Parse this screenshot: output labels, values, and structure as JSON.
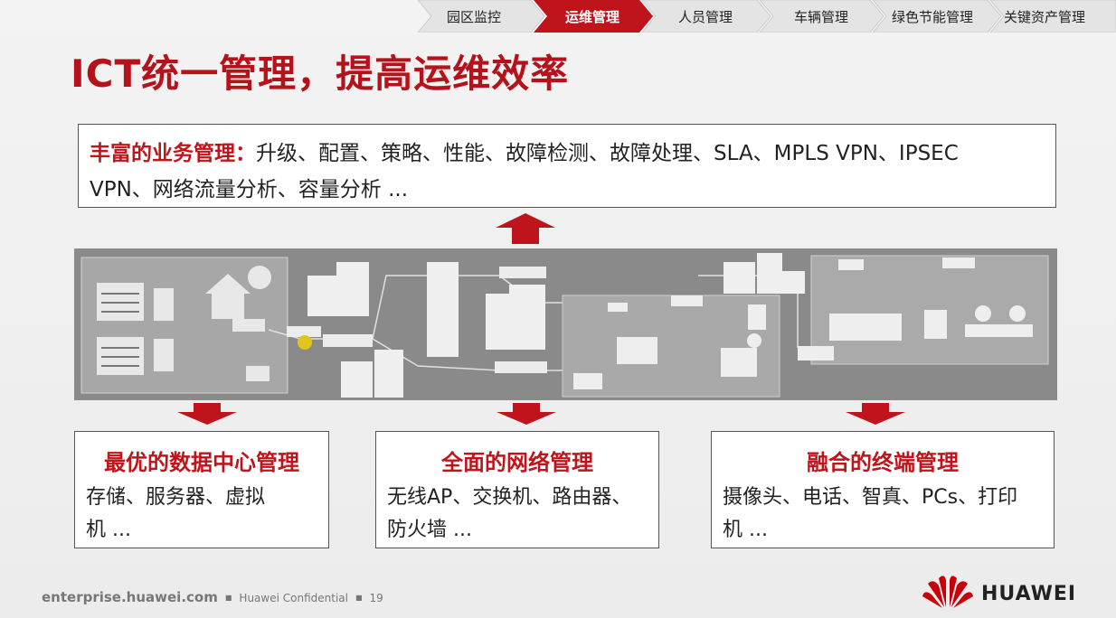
{
  "nav": {
    "tabs": [
      {
        "label": "园区监控"
      },
      {
        "label": "运维管理",
        "active": true
      },
      {
        "label": "人员管理"
      },
      {
        "label": "车辆管理"
      },
      {
        "label": "绿色节能管理"
      },
      {
        "label": "关键资产管理"
      }
    ],
    "active_color": "#c0141c"
  },
  "title": "ICT统一管理，提高运维效率",
  "top_box": {
    "heading": "丰富的业务管理：",
    "line1": "升级、配置、策略、性能、故障检测、故障处理、SLA、MPLS VPN、IPSEC",
    "line2": "VPN、网络流量分析、容量分析 ..."
  },
  "cards": [
    {
      "heading": "最优的数据中心管理",
      "line1": "存储、服务器、虚拟",
      "line2": "机 ..."
    },
    {
      "heading": "全面的网络管理",
      "line1": "无线AP、交换机、路由器、",
      "line2": "防火墙 ..."
    },
    {
      "heading": "融合的终端管理",
      "line1": "摄像头、电话、智真、PCs、打印",
      "line2": "机 ..."
    }
  ],
  "footer": {
    "site": "enterprise.huawei.com",
    "confidential": "Huawei Confidential",
    "page": "19"
  },
  "logo_text": "HUAWEI",
  "colors": {
    "brand_red": "#c0141c",
    "title_red": "#b5121b",
    "band_gray": "#888888"
  }
}
